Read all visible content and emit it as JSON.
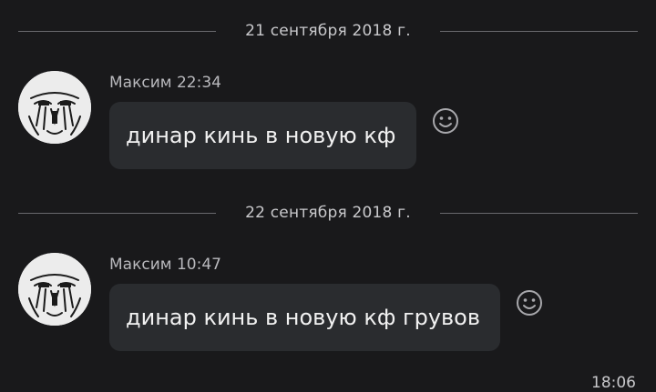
{
  "separators": [
    {
      "label": "21 сентября 2018 г."
    },
    {
      "label": "22 сентября 2018 г."
    }
  ],
  "messages": [
    {
      "author": "Максим",
      "time": "22:34",
      "text": "динар кинь в новую кф"
    },
    {
      "author": "Максим",
      "time": "10:47",
      "text": "динар кинь в новую кф грувов"
    }
  ],
  "footer_time": "18:06",
  "icons": {
    "reaction": "smiley-icon",
    "avatar": "avatar-drawing"
  },
  "colors": {
    "background": "#19191b",
    "bubble": "#2a2c2f",
    "separator_line": "#6a6a6e"
  }
}
